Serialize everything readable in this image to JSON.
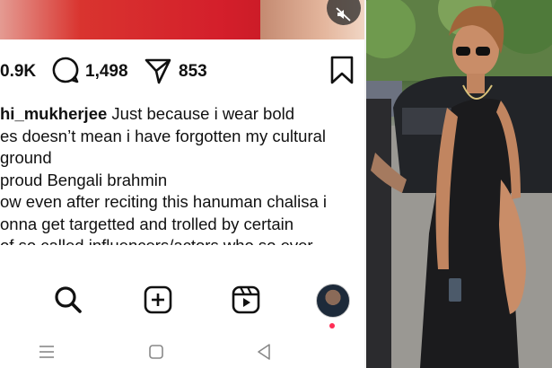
{
  "post": {
    "likes": "0.9K",
    "comments": "1,498",
    "shares": "853"
  },
  "caption": {
    "username": "hi_mukherjee",
    "lines": [
      " Just because i wear bold",
      "es doesn’t mean i have forgotten my cultural",
      "ground",
      " proud Bengali brahmin",
      "ow even after reciting this hanuman chalisa i",
      "onna get targetted and trolled by certain",
      " of so called influencers/actors who so ever"
    ]
  },
  "icons": {
    "mute": "speaker-muted-icon",
    "comment": "comment-bubble-icon",
    "share": "paper-plane-icon",
    "save": "bookmark-icon",
    "search": "search-icon",
    "create": "plus-square-icon",
    "reels": "reels-icon",
    "profile": "avatar",
    "sys_menu": "menu-lines-icon",
    "sys_home": "square-home-icon",
    "sys_back": "triangle-back-icon"
  },
  "colors": {
    "accent_dot": "#ff2d55",
    "text": "#111111"
  }
}
